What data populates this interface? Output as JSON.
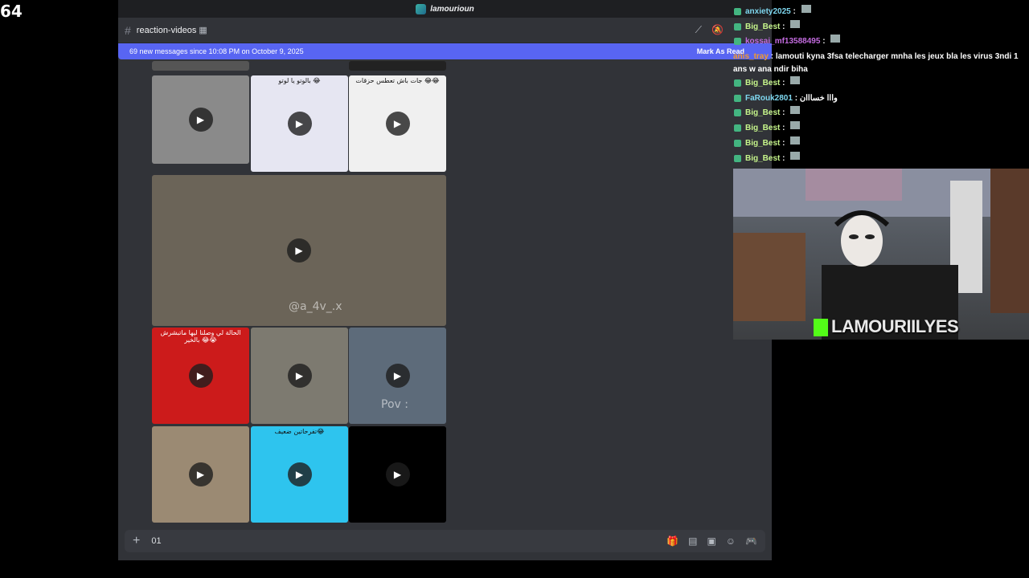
{
  "overlay_number": "64",
  "window": {
    "title": "lamourioun"
  },
  "channel": {
    "name": "reaction-videos",
    "emoji_suffix": "▦"
  },
  "new_messages": {
    "text": "69 new messages since 10:08 PM on October 9, 2025",
    "action": "Mark As Read"
  },
  "tiles": [
    {
      "caption": "",
      "bg": "#8a8a8a"
    },
    {
      "caption": "بالوتو يا لوتو 😂",
      "bg": "#e6e6f2"
    },
    {
      "caption": "جات باش تعطس حزقات 😂😂",
      "bg": "#f0f0f0"
    },
    {
      "caption": "",
      "bg": "#6b6458",
      "watermark": "@a_4v_.x"
    },
    {
      "caption": "الحالة لي وصلنا ليها ماتبشرش بالخير 😂😭",
      "bg": "#cc1b1b"
    },
    {
      "caption": "",
      "bg": "#7d7a70"
    },
    {
      "caption": "",
      "bg": "#5d6b7a",
      "watermark": "Pov :"
    },
    {
      "caption": "",
      "bg": "#9b8a73"
    },
    {
      "caption": "تفرحاتين ضعيف😂",
      "bg": "#2ec4ee"
    },
    {
      "caption": "",
      "bg": "#000000"
    }
  ],
  "composer": {
    "text": "01"
  },
  "chat": [
    {
      "user": "anxiety2025",
      "msg": "",
      "color": "cyan"
    },
    {
      "user": "Big_Best",
      "msg": "",
      "color": "green"
    },
    {
      "user": "kossai_mf13588495",
      "msg": "",
      "color": "pink"
    },
    {
      "user": "anis_tray",
      "msg": "lamouti kyna 3fsa telecharger mnha les jeux bla les virus 3ndi 1 ans w ana ndir biha",
      "color": "orange"
    },
    {
      "user": "Big_Best",
      "msg": "",
      "color": "green"
    },
    {
      "user": "FaRouk2801",
      "msg": "وااا خسااان",
      "color": "cyan"
    },
    {
      "user": "Big_Best",
      "msg": "",
      "color": "green"
    },
    {
      "user": "Big_Best",
      "msg": "",
      "color": "green"
    },
    {
      "user": "Big_Best",
      "msg": "",
      "color": "green"
    },
    {
      "user": "Big_Best",
      "msg": "",
      "color": "green"
    }
  ],
  "webcam": {
    "name": "LAMOURIILYES"
  }
}
